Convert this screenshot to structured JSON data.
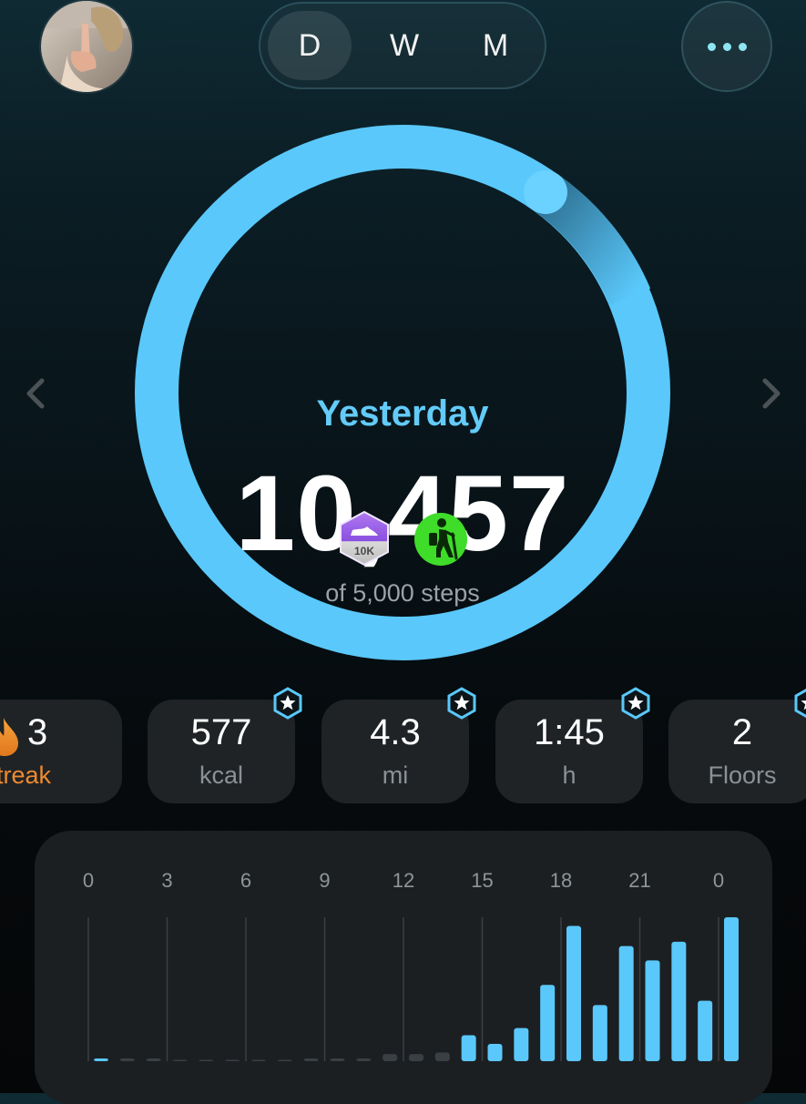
{
  "header": {
    "period_tabs": [
      {
        "label": "D",
        "active": true
      },
      {
        "label": "W",
        "active": false
      },
      {
        "label": "M",
        "active": false
      }
    ],
    "more_icon": "ellipsis-icon",
    "avatar_icon": "profile-photo"
  },
  "steps": {
    "day_label": "Yesterday",
    "value": "10,457",
    "goal_text": "of 5,000 steps",
    "goal_progress": 1.0,
    "ring_color": "#5ac8fa",
    "badges": [
      {
        "name": "10k-steps-badge",
        "label": "10K"
      },
      {
        "name": "hiking-badge"
      }
    ]
  },
  "stats": {
    "streak": {
      "value": "3",
      "unit": "Streak",
      "icon": "flame-icon"
    },
    "cards": [
      {
        "value": "577",
        "unit": "kcal",
        "starred": true
      },
      {
        "value": "4.3",
        "unit": "mi",
        "starred": true
      },
      {
        "value": "1:45",
        "unit": "h",
        "starred": true
      },
      {
        "value": "2",
        "unit": "Floors",
        "starred": true
      }
    ]
  },
  "colors": {
    "accent": "#5ac8fa",
    "streak": "#ef8a2e",
    "card_bg": "#1f2326"
  },
  "chart_data": {
    "type": "bar",
    "tick_labels": [
      "0",
      "3",
      "6",
      "9",
      "12",
      "15",
      "18",
      "21",
      "0"
    ],
    "x": [
      0,
      1,
      2,
      3,
      4,
      5,
      6,
      7,
      8,
      9,
      10,
      11,
      12,
      13,
      14,
      15,
      16,
      17,
      18,
      19,
      20,
      21,
      22,
      23
    ],
    "values": [
      0.01,
      0.005,
      0.005,
      0,
      0,
      0,
      0,
      0,
      0.005,
      0.005,
      0.01,
      0.05,
      0.05,
      0.06,
      0.18,
      0.12,
      0.23,
      0.53,
      0.94,
      0.39,
      0.8,
      0.7,
      0.83,
      0.42,
      1.0
    ],
    "values_scale": "relative to tallest bar (hour 23)",
    "bar_color": "#5ac8fa",
    "inactive_bar_color": "#3a3f43",
    "grid": "vertical lines at each 3-hour tick"
  }
}
